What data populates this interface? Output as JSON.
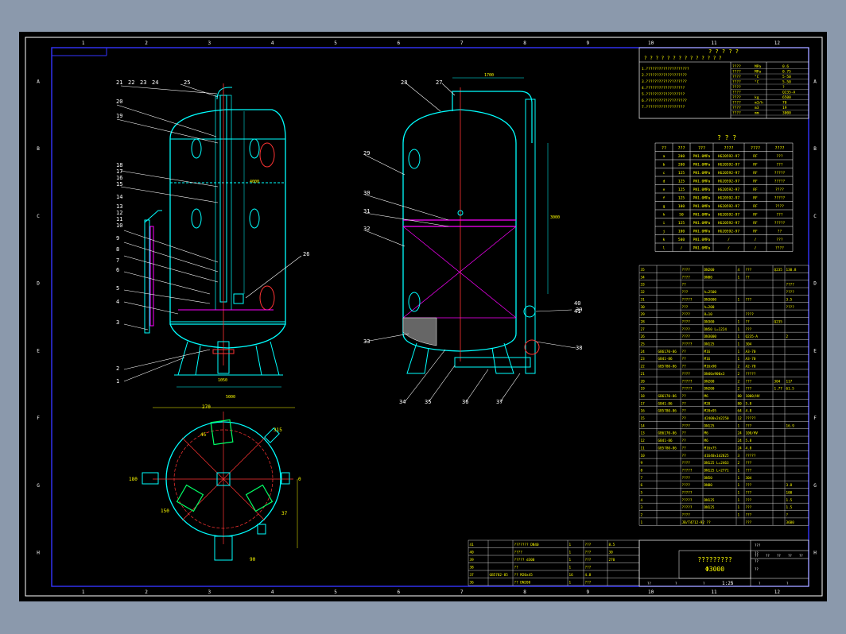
{
  "viewer": {
    "background": "#000000",
    "frame_color": "#0000ff",
    "border_color": "#ffffff",
    "outline_color": "#00ffff",
    "ref_line_color": "#ff3333",
    "accent_color": "#ff00ff",
    "table_text_color": "#ffff00"
  },
  "grid": {
    "columns": [
      "1",
      "2",
      "3",
      "4",
      "5",
      "6",
      "7",
      "8",
      "9",
      "10",
      "11",
      "12"
    ],
    "rows": [
      "A",
      "B",
      "C",
      "D",
      "E",
      "F",
      "G",
      "H"
    ]
  },
  "front_view": {
    "labels": [
      "21",
      "22",
      "23",
      "24",
      "25",
      "20",
      "19",
      "18",
      "17",
      "16",
      "15",
      "14",
      "13",
      "12",
      "11",
      "10",
      "9",
      "8",
      "7",
      "6",
      "5",
      "4",
      "3",
      "2",
      "1",
      "26"
    ],
    "dims": [
      "1050",
      "4000",
      "5000"
    ]
  },
  "side_view": {
    "labels": [
      "28",
      "27",
      "29",
      "30",
      "31",
      "32",
      "33",
      "34",
      "35",
      "36",
      "37",
      "38",
      "39",
      "40",
      "41"
    ],
    "dims": [
      "1700",
      "3000"
    ]
  },
  "plan_view": {
    "labels": [
      "270",
      "315",
      "45",
      "150",
      "37",
      "90",
      "180",
      "0"
    ]
  },
  "tech_req": {
    "title": "? ? ? ? ?",
    "header": "? ? ? ? ? ? ? ? ? ? ? ? ? ?",
    "lines": [
      "1.????????????????????",
      "2.???????????????????",
      "3.???????????????????",
      "4.??????????????????",
      "5.??????????????????",
      "6.???????????????????",
      "7.??????????????????"
    ],
    "params": [
      {
        "name": "????",
        "unit": "MPa",
        "value": "0.6"
      },
      {
        "name": "????",
        "unit": "MPa",
        "value": "0.75"
      },
      {
        "name": "????",
        "unit": "°C",
        "value": "5-50"
      },
      {
        "name": "????",
        "unit": "°C",
        "value": "5-50"
      },
      {
        "name": "????",
        "unit": "",
        "value": "?"
      },
      {
        "name": "????",
        "unit": "",
        "value": "Q235-A"
      },
      {
        "name": "????",
        "unit": "kg",
        "value": "6500"
      },
      {
        "name": "????",
        "unit": "m3/h",
        "value": "70"
      },
      {
        "name": "????",
        "unit": "m3",
        "value": "19"
      },
      {
        "name": "????",
        "unit": "mm",
        "value": "3000"
      }
    ]
  },
  "nozzle_table": {
    "title": "? ? ?",
    "headers": [
      "??",
      "???",
      "???",
      "????",
      "????",
      "????"
    ],
    "rows": [
      [
        "a",
        "200",
        "PN1.0MPa",
        "HG20592-97",
        "RF",
        "???"
      ],
      [
        "b",
        "200",
        "PN1.0MPa",
        "HG20592-97",
        "RF",
        "???"
      ],
      [
        "c",
        "125",
        "PN1.0MPa",
        "HG20592-97",
        "RF",
        "?????"
      ],
      [
        "d",
        "125",
        "PN1.0MPa",
        "HG20592-97",
        "RF",
        "?????"
      ],
      [
        "e",
        "125",
        "PN1.0MPa",
        "HG20592-97",
        "RF",
        "????"
      ],
      [
        "f",
        "125",
        "PN1.0MPa",
        "HG20592-97",
        "RF",
        "?????"
      ],
      [
        "g",
        "100",
        "PN1.0MPa",
        "HG20592-97",
        "RF",
        "????"
      ],
      [
        "h",
        "50",
        "PN1.0MPa",
        "HG20592-97",
        "RF",
        "???"
      ],
      [
        "i",
        "125",
        "PN1.0MPa",
        "HG20592-97",
        "RF",
        "?????"
      ],
      [
        "j",
        "100",
        "PN1.0MPa",
        "HG20592-97",
        "RF",
        "??"
      ],
      [
        "k",
        "500",
        "PN1.0MPa",
        "/",
        "/",
        "???"
      ],
      [
        "l",
        "/",
        "PN1.0MPa",
        "/",
        "/",
        "????"
      ]
    ]
  },
  "parts_list": [
    [
      "35",
      "",
      "????",
      "DN200",
      "4",
      "???",
      "Q235",
      "130.8"
    ],
    [
      "34",
      "",
      "????",
      "DN80",
      "1",
      "??",
      "",
      ""
    ],
    [
      "33",
      "",
      "??",
      "",
      "",
      "",
      "",
      "????"
    ],
    [
      "32",
      "",
      "???",
      "h=2500",
      "",
      "",
      "",
      "????"
    ],
    [
      "31",
      "",
      "?????",
      "DN3000",
      "1",
      "???",
      "",
      "3.5"
    ],
    [
      "30",
      "",
      "???",
      "h=200",
      "",
      "",
      "",
      "????"
    ],
    [
      "29",
      "",
      "????",
      "8=10",
      "",
      "????",
      "",
      ""
    ],
    [
      "28",
      "",
      "????",
      "DN300",
      "1",
      "??",
      "Q235",
      ""
    ],
    [
      "27",
      "",
      "????",
      "DN50 L=1224",
      "1",
      "???",
      "",
      ""
    ],
    [
      "26",
      "",
      "????",
      "DN3000",
      "1",
      "Q235-A",
      "",
      "2"
    ],
    [
      "25",
      "",
      "?????",
      "DN125",
      "1",
      "304",
      "",
      ""
    ],
    [
      "24",
      "GB6170-86",
      "??",
      "M16",
      "1",
      "A3-70",
      "",
      ""
    ],
    [
      "23",
      "GB41-86",
      "??",
      "M16",
      "1",
      "A3-70",
      "",
      ""
    ],
    [
      "22",
      "GB5780-86",
      "??",
      "M16x90",
      "2",
      "A2-70",
      "",
      ""
    ],
    [
      "21",
      "",
      "????",
      "DN40x900x3",
      "2",
      "?????",
      "",
      ""
    ],
    [
      "20",
      "",
      "?????",
      "DN200",
      "2",
      "???",
      "304",
      "117"
    ],
    [
      "19",
      "",
      "?????",
      "DN200",
      "2",
      "???",
      "1.77",
      "61.5"
    ],
    [
      "18",
      "GB6170-86",
      "??",
      "M6",
      "80",
      "1000/HV",
      "",
      ""
    ],
    [
      "17",
      "GB41-86",
      "??",
      "M20",
      "80",
      "5.8",
      "",
      ""
    ],
    [
      "16",
      "GB5780-86",
      "??",
      "M20x95",
      "64",
      "4.8",
      "",
      ""
    ],
    [
      "15",
      "",
      "??",
      "d2400x2d2250",
      "12",
      "?????",
      "",
      ""
    ],
    [
      "14",
      "",
      "????",
      "DN125",
      "1",
      "???",
      "",
      "16.9"
    ],
    [
      "13",
      "GB6170-86",
      "??",
      "M6",
      "24",
      "100/HV",
      "",
      ""
    ],
    [
      "12",
      "GB41-86",
      "??",
      "M6",
      "24",
      "5.8",
      "",
      ""
    ],
    [
      "11",
      "GB5780-86",
      "??",
      "M16x75",
      "24",
      "4.8",
      "",
      ""
    ],
    [
      "10",
      "",
      "??",
      "d1640x1d2025",
      "3",
      "?????",
      "",
      ""
    ],
    [
      "9",
      "",
      "????",
      "DN125 L=2463",
      "2",
      "???",
      "",
      ""
    ],
    [
      "8",
      "",
      "?????",
      "DN125 L=2771",
      "1",
      "???",
      "",
      ""
    ],
    [
      "7",
      "",
      "????",
      "DN50",
      "1",
      "304",
      "",
      ""
    ],
    [
      "6",
      "",
      "????",
      "DN80",
      "1",
      "???",
      "",
      "3.8"
    ],
    [
      "5",
      "",
      "?????",
      "",
      "1",
      "???",
      "",
      "100"
    ],
    [
      "4",
      "",
      "?????",
      "DN125",
      "1",
      "???",
      "",
      "1.5"
    ],
    [
      "3",
      "",
      "?????",
      "DN125",
      "1",
      "???",
      "",
      "1.5"
    ],
    [
      "2",
      "",
      "????",
      "",
      "1",
      "???",
      "",
      "?"
    ],
    [
      "1",
      "",
      "JB/T4712-92 ??",
      "",
      "",
      "???",
      "",
      "3600"
    ]
  ],
  "bottom_table": [
    [
      "41",
      "",
      "???????",
      "DN40",
      "1",
      "???",
      "",
      "8.5"
    ],
    [
      "40",
      "",
      "????",
      "",
      "1",
      "???",
      "",
      "30"
    ],
    [
      "39",
      "",
      "?????",
      "d300",
      "1",
      "???",
      "",
      "270"
    ],
    [
      "38",
      "",
      "??",
      "",
      "1",
      "???",
      "",
      ""
    ],
    [
      "37",
      "GB5782-85",
      "??",
      "M20x45",
      "16",
      "4.8",
      "",
      ""
    ],
    [
      "36",
      "",
      "??",
      "DN200",
      "1",
      "???",
      "",
      ""
    ]
  ],
  "title_block": {
    "name": "?????????",
    "spec": "Φ3000",
    "scale": "1:25",
    "header_cols": [
      "??",
      "??",
      "??",
      "??",
      "??"
    ],
    "bottom_cells": [
      "??",
      "?",
      "?",
      "?",
      "?",
      "?"
    ],
    "mini": [
      "???",
      "??",
      "??",
      "??"
    ]
  }
}
